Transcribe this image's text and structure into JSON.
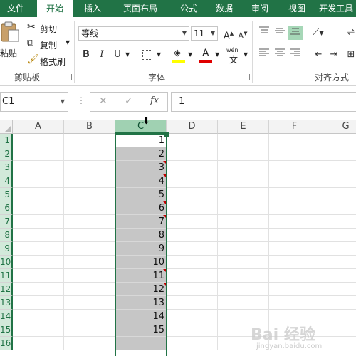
{
  "tabs": [
    "文件",
    "开始",
    "插入",
    "页面布局",
    "公式",
    "数据",
    "审阅",
    "视图",
    "开发工具"
  ],
  "clipboard": {
    "paste_label": "粘贴",
    "cut_label": "剪切",
    "copy_label": "复制",
    "format_painter_label": "格式刷",
    "group_label": "剪贴板"
  },
  "font": {
    "font_name": "等线",
    "font_size": "11",
    "grow_label": "A",
    "shrink_label": "A",
    "bold": "B",
    "italic": "I",
    "underline": "U",
    "font_color_letter": "A",
    "phonetic_label": "wén",
    "group_label": "字体"
  },
  "alignment": {
    "group_label": "对齐方式"
  },
  "formula_bar": {
    "name_box": "C1",
    "cancel_symbol": "✕",
    "enter_symbol": "✓",
    "fx_label": "fx",
    "content": "1"
  },
  "columns": [
    "A",
    "B",
    "C",
    "D",
    "E",
    "F",
    "G"
  ],
  "rows": [
    "1",
    "2",
    "3",
    "4",
    "5",
    "6",
    "7",
    "8",
    "9",
    "10",
    "11",
    "12",
    "13",
    "14",
    "15",
    "16"
  ],
  "column_c_values": [
    "1",
    "2",
    "3",
    "4",
    "5",
    "6",
    "7",
    "8",
    "9",
    "10",
    "11",
    "12",
    "13",
    "14",
    "15",
    ""
  ],
  "selected_column": "C",
  "active_cell": "C1",
  "watermark": "Bai 经验",
  "watermark_sub": "jingyan.baidu.com",
  "colors": {
    "accent": "#217346",
    "selection_fill": "#c6c6c6",
    "header_selected": "#a0d1b2",
    "error_triangle": "#c00000"
  }
}
